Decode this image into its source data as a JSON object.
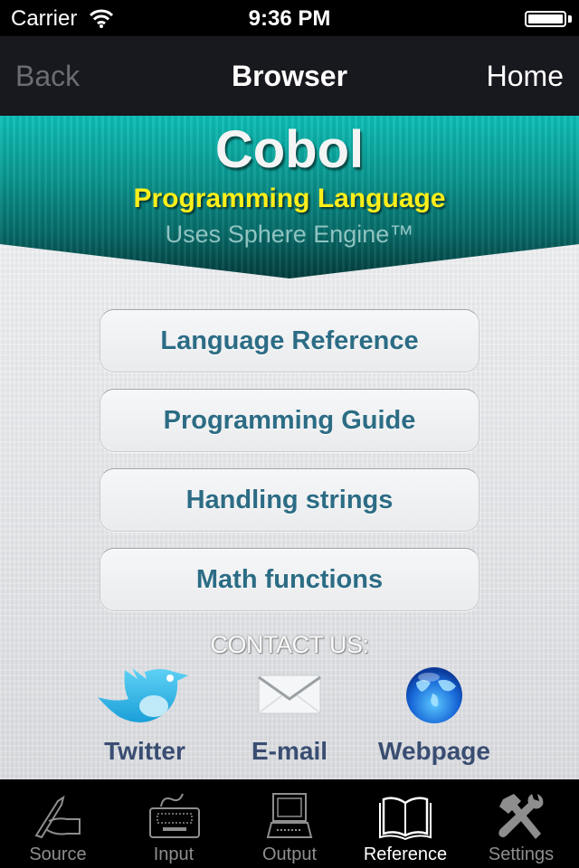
{
  "status_bar": {
    "carrier": "Carrier",
    "time": "9:36 PM",
    "battery_level": 1.0
  },
  "nav": {
    "back_label": "Back",
    "title": "Browser",
    "home_label": "Home"
  },
  "banner": {
    "title": "Cobol",
    "subtitle": "Programming Language",
    "engine": "Uses Sphere Engine™"
  },
  "menu": {
    "items": [
      {
        "label": "Language Reference"
      },
      {
        "label": "Programming Guide"
      },
      {
        "label": "Handling strings"
      },
      {
        "label": "Math functions"
      }
    ]
  },
  "contact": {
    "heading": "CONTACT US:",
    "items": [
      {
        "label": "Twitter",
        "icon": "twitter-bird-icon"
      },
      {
        "label": "E-mail",
        "icon": "envelope-icon"
      },
      {
        "label": "Webpage",
        "icon": "globe-icon"
      }
    ]
  },
  "tab_bar": {
    "active": "Reference",
    "tabs": [
      {
        "label": "Source",
        "icon": "pen-hand-icon"
      },
      {
        "label": "Input",
        "icon": "keyboard-icon"
      },
      {
        "label": "Output",
        "icon": "computer-icon"
      },
      {
        "label": "Reference",
        "icon": "book-icon"
      },
      {
        "label": "Settings",
        "icon": "tools-icon"
      }
    ]
  },
  "colors": {
    "banner_teal": "#0a9a93",
    "subtitle_yellow": "#ffef1a",
    "button_text": "#2c6c85",
    "contact_text": "#3a4d72"
  }
}
